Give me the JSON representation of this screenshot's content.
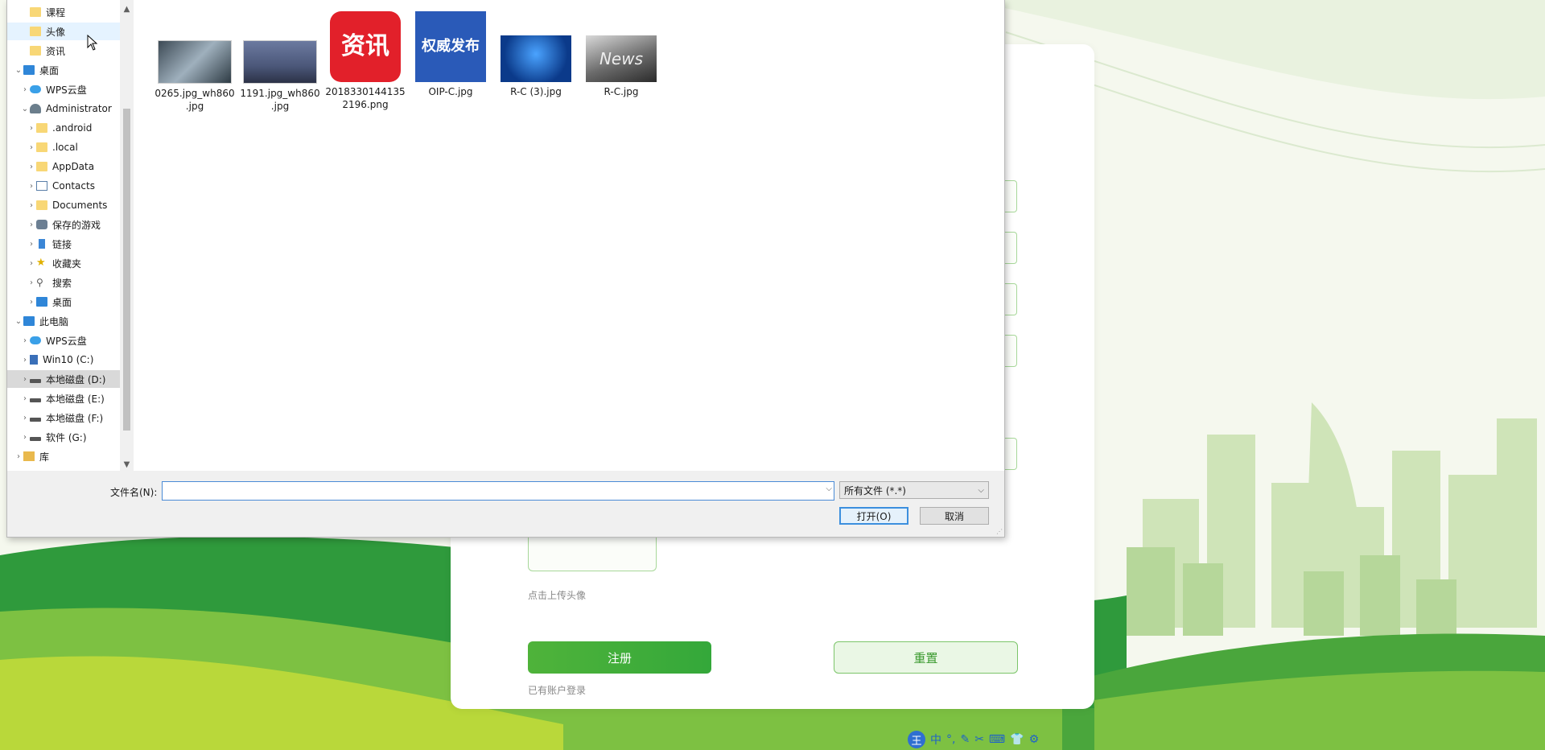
{
  "page": {
    "upload_hint": "点击上传头像",
    "register_label": "注册",
    "reset_label": "重置",
    "login_link": "已有账户登录"
  },
  "dialog": {
    "tree": [
      {
        "label": "课程",
        "icon": "folder-icon",
        "level": 1
      },
      {
        "label": "头像",
        "icon": "folder-icon",
        "level": 1,
        "state": "hover"
      },
      {
        "label": "资讯",
        "icon": "folder-icon",
        "level": 1
      },
      {
        "label": "桌面",
        "icon": "desktop-icon",
        "level": 0,
        "expanded": true
      },
      {
        "label": "WPS云盘",
        "icon": "cloud-icon",
        "level": 1
      },
      {
        "label": "Administrator",
        "icon": "user-icon",
        "level": 1,
        "expanded": true
      },
      {
        "label": ".android",
        "icon": "folder-icon",
        "level": 2
      },
      {
        "label": ".local",
        "icon": "folder-icon",
        "level": 2
      },
      {
        "label": "AppData",
        "icon": "folder-icon",
        "level": 2
      },
      {
        "label": "Contacts",
        "icon": "contacts-icon",
        "level": 2
      },
      {
        "label": "Documents",
        "icon": "folder-icon",
        "level": 2
      },
      {
        "label": "保存的游戏",
        "icon": "saved-games-icon",
        "level": 2
      },
      {
        "label": "链接",
        "icon": "link-icon",
        "level": 2
      },
      {
        "label": "收藏夹",
        "icon": "star-icon",
        "level": 2
      },
      {
        "label": "搜索",
        "icon": "search-icon",
        "level": 2
      },
      {
        "label": "桌面",
        "icon": "desktop-icon",
        "level": 2
      },
      {
        "label": "此电脑",
        "icon": "pc-icon",
        "level": 0,
        "expanded": true
      },
      {
        "label": "WPS云盘",
        "icon": "cloud-icon",
        "level": 1
      },
      {
        "label": "Win10 (C:)",
        "icon": "network-drive-icon",
        "level": 1
      },
      {
        "label": "本地磁盘 (D:)",
        "icon": "drive-icon",
        "level": 1,
        "state": "selected"
      },
      {
        "label": "本地磁盘 (E:)",
        "icon": "drive-icon",
        "level": 1
      },
      {
        "label": "本地磁盘 (F:)",
        "icon": "drive-icon",
        "level": 1
      },
      {
        "label": "软件 (G:)",
        "icon": "drive-icon",
        "level": 1
      },
      {
        "label": "库",
        "icon": "library-icon",
        "level": 0
      }
    ],
    "files": [
      {
        "name": "0265.jpg_wh860\n.jpg",
        "line1": "0265.jpg_wh860",
        "line2": ".jpg"
      },
      {
        "name": "1191.jpg_wh860.jpg",
        "line1": "1191.jpg_wh860",
        "line2": ".jpg"
      },
      {
        "name": "20183301441352196.png",
        "line1": "2018330144135",
        "line2": "2196.png",
        "thumb_text": "资讯"
      },
      {
        "name": "OIP-C.jpg",
        "line1": "OIP-C.jpg",
        "line2": "",
        "thumb_text": "权威发布"
      },
      {
        "name": "R-C (3).jpg",
        "line1": "R-C (3).jpg",
        "line2": ""
      },
      {
        "name": "R-C.jpg",
        "line1": "R-C.jpg",
        "line2": "",
        "thumb_text": "News"
      }
    ],
    "filename_label": "文件名(N):",
    "filename_value": "",
    "filetype_value": "所有文件 (*.*)",
    "open_label": "打开(O)",
    "cancel_label": "取消"
  },
  "ime": {
    "logo": "王",
    "mode": "中"
  },
  "colors": {
    "brand_green": "#3aa83a",
    "accent_blue": "#3c8fde"
  }
}
